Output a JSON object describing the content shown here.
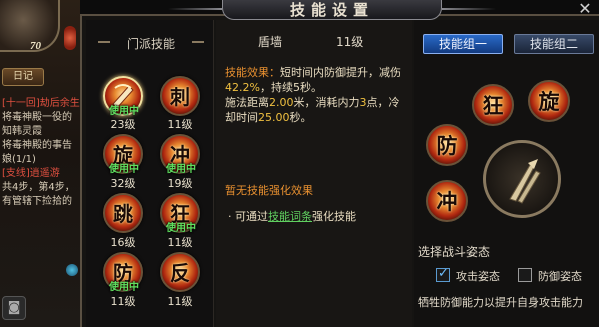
{
  "player": {
    "level": "70"
  },
  "quest_tracker": {
    "button_label": "日记",
    "lines": [
      {
        "text": "[十一回]劫后余生",
        "tone": "red"
      },
      {
        "text": "将毒神殿一役的",
        "tone": "normal"
      },
      {
        "text": "知韩灵霞",
        "tone": "normal"
      },
      {
        "text": "将毒神殿的事告",
        "tone": "normal"
      },
      {
        "text": "娘(1/1)",
        "tone": "normal"
      },
      {
        "text": "[支线]逍遥游",
        "tone": "red"
      },
      {
        "text": "共4步，第4步，",
        "tone": "normal"
      },
      {
        "text": "有管辖下捡拾的",
        "tone": "normal"
      }
    ]
  },
  "window": {
    "title": "技能设置",
    "close": "✕"
  },
  "sect_skills": {
    "header": "门派技能",
    "in_use_label": "使用中",
    "skills": [
      {
        "glyph": "",
        "level": "23级",
        "in_use": true,
        "selected": true
      },
      {
        "glyph": "刺",
        "level": "11级",
        "in_use": false,
        "selected": false
      },
      {
        "glyph": "旋",
        "level": "32级",
        "in_use": true,
        "selected": false
      },
      {
        "glyph": "冲",
        "level": "19级",
        "in_use": true,
        "selected": false
      },
      {
        "glyph": "跳",
        "level": "16级",
        "in_use": false,
        "selected": false
      },
      {
        "glyph": "狂",
        "level": "11级",
        "in_use": true,
        "selected": false
      },
      {
        "glyph": "防",
        "level": "11级",
        "in_use": true,
        "selected": false
      },
      {
        "glyph": "反",
        "level": "11级",
        "in_use": false,
        "selected": false
      }
    ]
  },
  "detail": {
    "skill_name": "盾墙",
    "skill_level": "11级",
    "effect_label": "技能效果：",
    "effect_line1": "短时间内防御提升，减伤",
    "effect_pct": "42.2%",
    "effect_line2_rest": "，持续5秒。",
    "cast_prefix": "施法距离",
    "cast_distance": "2.00",
    "cast_mid": "米，消耗内力",
    "cast_mana": "3",
    "cast_suffix": "点，冷",
    "cd_prefix": "却时间",
    "cd_value": "25.00",
    "cd_suffix": "秒。",
    "no_enhance": "暂无技能强化效果",
    "enhance_prefix": "· 可通过",
    "enhance_link": "技能词条",
    "enhance_suffix": "强化技能"
  },
  "skill_groups": {
    "group1": "技能组一",
    "group2": "技能组二"
  },
  "equipped_slots": [
    {
      "glyph": "狂"
    },
    {
      "glyph": "旋"
    },
    {
      "glyph": "防"
    },
    {
      "glyph": "冲"
    }
  ],
  "stance": {
    "title": "选择战斗姿态",
    "attack": {
      "label": "攻击姿态",
      "checked": true
    },
    "defense": {
      "label": "防御姿态",
      "checked": false
    },
    "description": "牺牲防御能力以提升自身攻击能力"
  },
  "colors": {
    "accent_blue": "#2a6ac8",
    "in_use_green": "#60e060",
    "highlight_yellow": "#f0c040",
    "label_orange": "#e89030"
  }
}
